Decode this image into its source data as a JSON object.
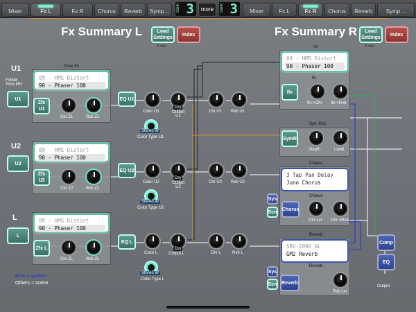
{
  "tabs_left": [
    "Mixer",
    "Fx L",
    "Fx R",
    "Chorus",
    "Reverb",
    "Symp…"
  ],
  "tabs_right": [
    "Mixer",
    "Fx L",
    "Fx R",
    "Chorus",
    "Reverb",
    "Symp…"
  ],
  "bank_word": "bank",
  "bank_left": "3",
  "bank_right": "3",
  "more_label": "more",
  "title_left": "Fx Summary L",
  "title_right": "Fx Summary R",
  "load_settings": "Load Settings",
  "load_settings_sub": "2 sec",
  "index_label": "Index",
  "zone_fx_label": "Zone Fx",
  "follow_tone": "Follow Tone Mfx",
  "rows": [
    {
      "ch": "U1",
      "btn": "U1",
      "fx_top": "09 - HMS Distort",
      "fx_bot": "90 - Phaser 100",
      "zfx": "Zfx U1",
      "chr": "Chr Z1",
      "rvb": "Rvb Z1",
      "eq": "EQ U1",
      "color": "Color U1",
      "output": "Output U1",
      "ctype": "Color Type U1",
      "chr2": "Chr U1",
      "rvb2": "Rvb U1"
    },
    {
      "ch": "U2",
      "btn": "U2",
      "fx_top": "09 - HMS Distort",
      "fx_bot": "90 - Phaser 100",
      "zfx": "Zfx U2",
      "chr": "Chr Z2",
      "rvb": "Rvb Z2",
      "eq": "EQ U2",
      "color": "Color U2",
      "output": "Output U2",
      "ctype": "Color Type U2",
      "chr2": "Chr U2",
      "rvb2": "Rvb U2"
    },
    {
      "ch": "L",
      "btn": "L",
      "fx_top": "09 - HMS Distort",
      "fx_bot": "90 - Phaser 100",
      "zfx": "Zfx L",
      "chr": "Chr ZL",
      "rvb": "Rvb ZL",
      "eq": "EQ L",
      "color": "Color L",
      "output": "Output L",
      "ctype": "Color Type L",
      "chr2": "Chr L",
      "rvb2": "Rvb L"
    }
  ],
  "stereo_w": "Stereo W",
  "dry": "Dry",
  "ifx": {
    "label": "Ifx",
    "fx_top": "09 - HMS Distort",
    "fx_bot": "90 - Phaser 100",
    "btn": "Ifx",
    "k1": "Ifx->Chr",
    "k2": "Ifx->Rvb"
  },
  "symrez": {
    "label": "Sym Rez",
    "btn": "SymR",
    "k1": "Depth",
    "k2": "Level"
  },
  "chorus": {
    "label": "Chorus",
    "fx_top": "3 Tap Pan Delay",
    "fx_bot": "Juno Chorus",
    "btn": "Chorus",
    "k1": "Chr Lvl",
    "k2": "Chr->Rvb",
    "sys": "Sys",
    "scn": "Scn"
  },
  "reverb": {
    "label": "Reverb",
    "fx_top": "SRV-2000 NL",
    "fx_bot": "GM2 Reverb",
    "btn": "Reverb",
    "k1": "Rvb Lvl",
    "sys": "Sys",
    "scn": "Scn"
  },
  "comp": "Comp",
  "eq": "EQ",
  "output_label": "Output",
  "legend_blue": "Blue = system",
  "legend_others": "Others = scene",
  "colors": {
    "accent": "#6ee8c8",
    "system_blue": "#3c52b0",
    "scene_red": "#b4524a",
    "wire_orange": "#d58a3c",
    "wire_blue": "#2233cc",
    "wire_green": "#2fb44a"
  }
}
